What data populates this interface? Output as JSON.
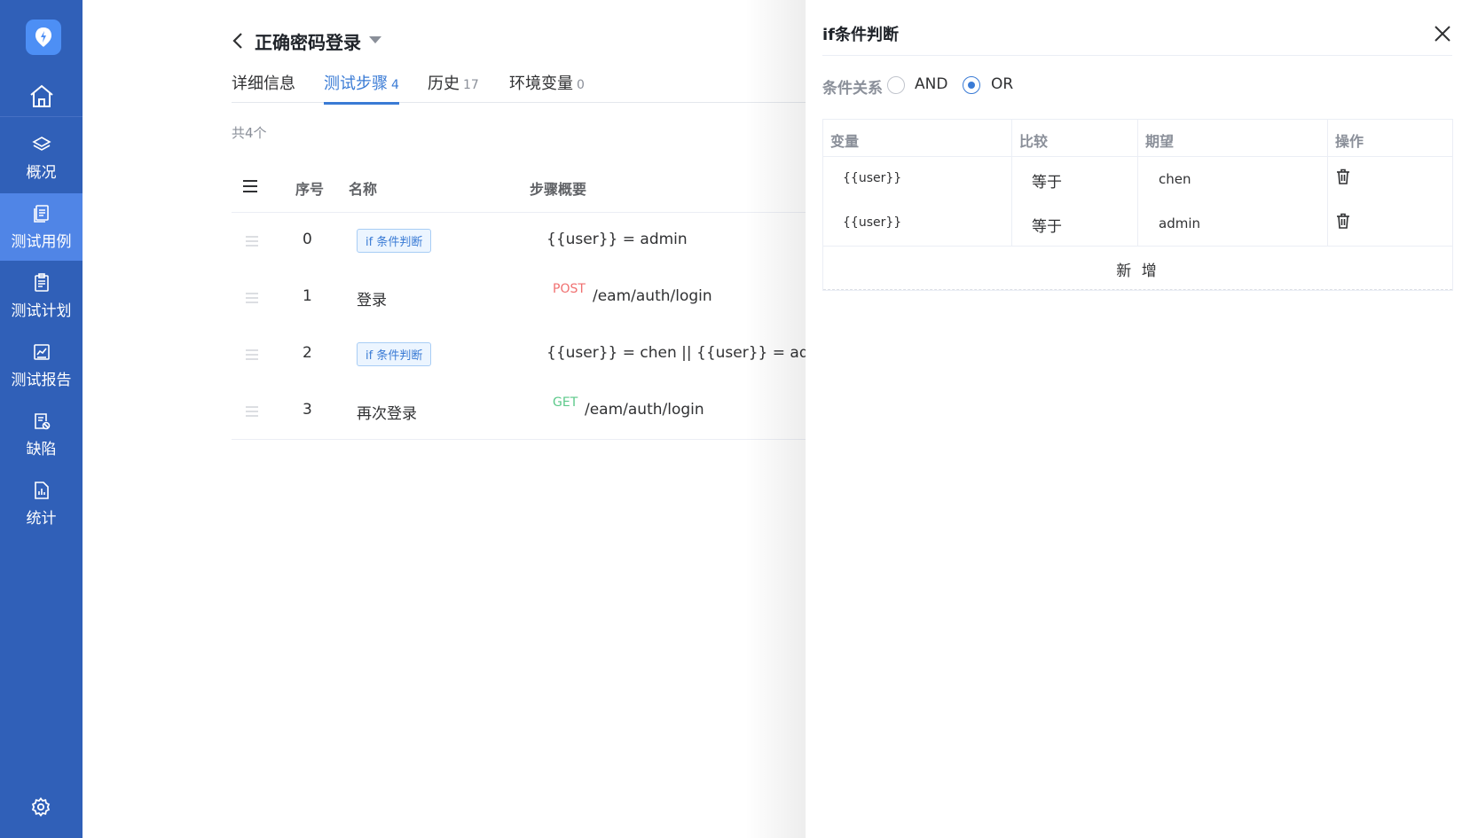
{
  "sidebar": {
    "items": [
      {
        "label": "概况",
        "icon": "layers-icon"
      },
      {
        "label": "测试用例",
        "icon": "document-icon",
        "active": true
      },
      {
        "label": "测试计划",
        "icon": "clipboard-icon"
      },
      {
        "label": "测试报告",
        "icon": "chart-report-icon"
      },
      {
        "label": "缺陷",
        "icon": "bug-file-icon"
      },
      {
        "label": "统计",
        "icon": "statistics-icon"
      }
    ]
  },
  "header": {
    "title": "正确密码登录"
  },
  "tabs": [
    {
      "label": "详细信息",
      "count": ""
    },
    {
      "label": "测试步骤",
      "count": "4",
      "active": true
    },
    {
      "label": "历史",
      "count": "17"
    },
    {
      "label": "环境变量",
      "count": "0"
    }
  ],
  "steps": {
    "total_text": "共4个",
    "columns": {
      "index": "序号",
      "name": "名称",
      "summary": "步骤概要"
    },
    "rows": [
      {
        "index": "0",
        "tag": "if 条件判断",
        "summary": "{{user}} = admin"
      },
      {
        "index": "1",
        "name": "登录",
        "method": "POST",
        "path": "/eam/auth/login"
      },
      {
        "index": "2",
        "tag": "if 条件判断",
        "summary": "{{user}} = chen || {{user}} = admin"
      },
      {
        "index": "3",
        "name": "再次登录",
        "method": "GET",
        "path": "/eam/auth/login"
      }
    ]
  },
  "drawer": {
    "title": "if条件判断",
    "relation_label": "条件关系",
    "options": {
      "and": "AND",
      "or": "OR"
    },
    "selected": "OR",
    "columns": {
      "variable": "变量",
      "compare": "比较",
      "expect": "期望",
      "action": "操作"
    },
    "rows": [
      {
        "variable": "{{user}}",
        "compare": "等于",
        "expect": "chen"
      },
      {
        "variable": "{{user}}",
        "compare": "等于",
        "expect": "admin"
      }
    ],
    "add_label": "新 增"
  },
  "colors": {
    "sidebar": "#3060b8",
    "sidebar_active": "#5085e6",
    "accent": "#3a7bd5",
    "post": "#f07070",
    "get": "#5cc98a"
  }
}
